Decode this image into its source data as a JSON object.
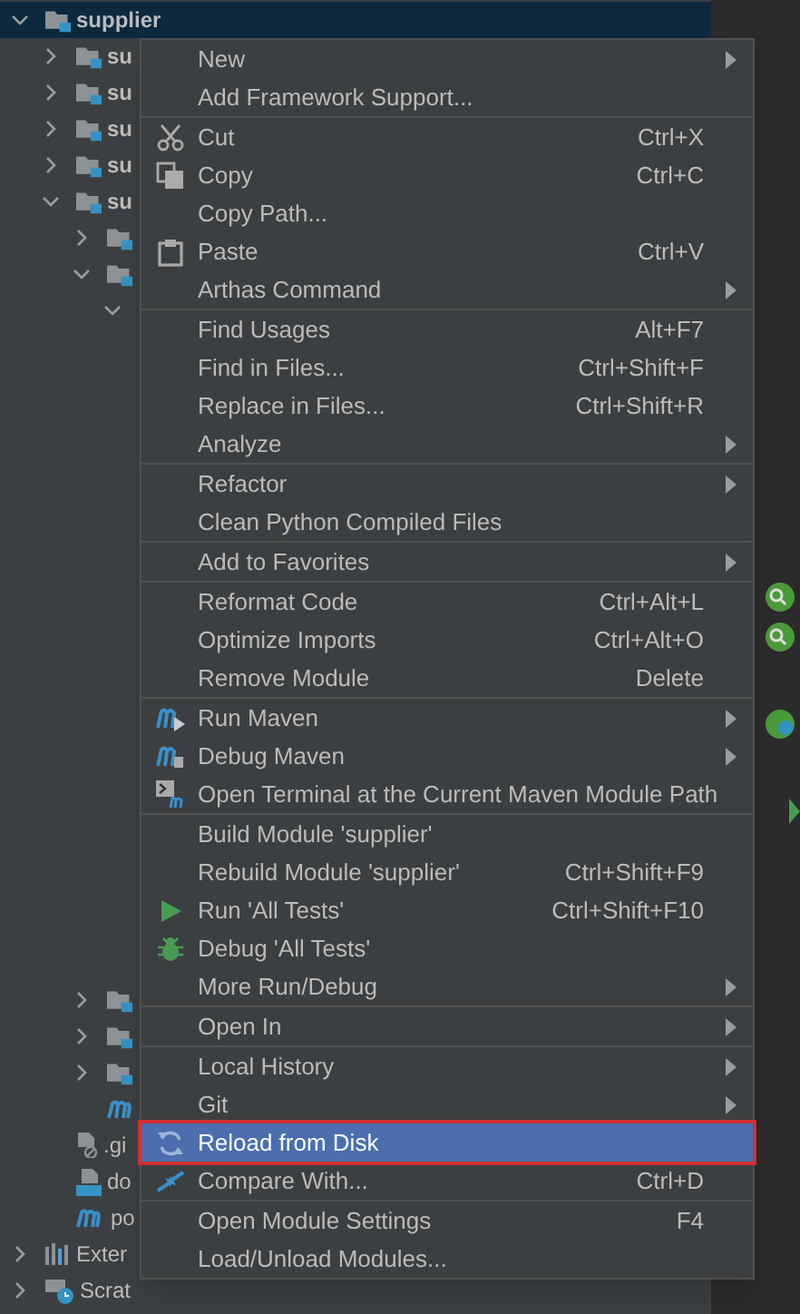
{
  "project_tree": {
    "items": [
      {
        "label": "supplier",
        "kind": "module",
        "expanded": true,
        "selected": true,
        "children": [
          {
            "label": "su",
            "kind": "module",
            "expanded": false,
            "selected": false
          },
          {
            "label": "su",
            "kind": "module",
            "expanded": false,
            "selected": false
          },
          {
            "label": "su",
            "kind": "module",
            "expanded": false,
            "selected": false
          },
          {
            "label": "su",
            "kind": "module",
            "expanded": false,
            "selected": false
          },
          {
            "label": "su",
            "kind": "module",
            "expanded": true,
            "selected": false,
            "children": [
              {
                "kind": "folder",
                "expanded": false,
                "selected": false
              },
              {
                "kind": "folder",
                "expanded": true,
                "selected": false,
                "children": [
                  {
                    "kind": "hidden",
                    "expanded": true
                  }
                ]
              },
              {
                "kind": "folder",
                "expanded": false,
                "selected": false
              },
              {
                "kind": "folder",
                "expanded": false,
                "selected": false
              },
              {
                "kind": "folder",
                "expanded": false,
                "selected": false
              },
              {
                "kind": "maven",
                "selected": false
              }
            ]
          },
          {
            "label": ".gi",
            "kind": "ignore",
            "selected": false
          },
          {
            "label": "do",
            "kind": "docker",
            "selected": false
          },
          {
            "label": "po",
            "kind": "maven",
            "selected": false
          }
        ]
      },
      {
        "label": "Exter",
        "kind": "library",
        "expanded": false,
        "selected": false
      },
      {
        "label": "Scrat",
        "kind": "scratch",
        "expanded": false,
        "selected": false
      }
    ]
  },
  "context_menu": {
    "sections": [
      {
        "items": [
          {
            "label": "New",
            "submenu": true,
            "selected": false
          },
          {
            "label": "Add Framework Support...",
            "submenu": false,
            "selected": false
          }
        ]
      },
      {
        "items": [
          {
            "label": "Cut",
            "shortcut": "Ctrl+X",
            "submenu": false,
            "selected": false
          },
          {
            "label": "Copy",
            "shortcut": "Ctrl+C",
            "submenu": false,
            "selected": false
          },
          {
            "label": "Copy Path...",
            "submenu": false,
            "selected": false
          },
          {
            "label": "Paste",
            "shortcut": "Ctrl+V",
            "submenu": false,
            "selected": false
          },
          {
            "label": "Arthas Command",
            "submenu": true,
            "selected": false
          }
        ]
      },
      {
        "items": [
          {
            "label": "Find Usages",
            "shortcut": "Alt+F7",
            "submenu": false,
            "selected": false
          },
          {
            "label": "Find in Files...",
            "shortcut": "Ctrl+Shift+F",
            "submenu": false,
            "selected": false
          },
          {
            "label": "Replace in Files...",
            "shortcut": "Ctrl+Shift+R",
            "submenu": false,
            "selected": false
          },
          {
            "label": "Analyze",
            "submenu": true,
            "selected": false
          }
        ]
      },
      {
        "items": [
          {
            "label": "Refactor",
            "submenu": true,
            "selected": false
          },
          {
            "label": "Clean Python Compiled Files",
            "submenu": false,
            "selected": false
          }
        ]
      },
      {
        "items": [
          {
            "label": "Add to Favorites",
            "submenu": true,
            "selected": false
          }
        ]
      },
      {
        "items": [
          {
            "label": "Reformat Code",
            "shortcut": "Ctrl+Alt+L",
            "submenu": false,
            "selected": false
          },
          {
            "label": "Optimize Imports",
            "shortcut": "Ctrl+Alt+O",
            "submenu": false,
            "selected": false
          },
          {
            "label": "Remove Module",
            "shortcut": "Delete",
            "submenu": false,
            "selected": false
          }
        ]
      },
      {
        "items": [
          {
            "label": "Run Maven",
            "submenu": true,
            "selected": false
          },
          {
            "label": "Debug Maven",
            "submenu": true,
            "selected": false
          },
          {
            "label": "Open Terminal at the Current Maven Module Path",
            "submenu": false,
            "selected": false
          }
        ]
      },
      {
        "items": [
          {
            "label": "Build Module 'supplier'",
            "submenu": false,
            "selected": false
          },
          {
            "label": "Rebuild Module 'supplier'",
            "shortcut": "Ctrl+Shift+F9",
            "submenu": false,
            "selected": false
          },
          {
            "label": "Run 'All Tests'",
            "shortcut": "Ctrl+Shift+F10",
            "submenu": false,
            "selected": false
          },
          {
            "label": "Debug 'All Tests'",
            "submenu": false,
            "selected": false
          },
          {
            "label": "More Run/Debug",
            "submenu": true,
            "selected": false
          }
        ]
      },
      {
        "items": [
          {
            "label": "Open In",
            "submenu": true,
            "selected": false
          }
        ]
      },
      {
        "items": [
          {
            "label": "Local History",
            "submenu": true,
            "selected": false
          },
          {
            "label": "Git",
            "submenu": true,
            "selected": false
          },
          {
            "label": "Reload from Disk",
            "submenu": false,
            "selected": true
          },
          {
            "label": "Compare With...",
            "shortcut": "Ctrl+D",
            "submenu": false,
            "selected": false
          }
        ]
      },
      {
        "items": [
          {
            "label": "Open Module Settings",
            "shortcut": "F4",
            "submenu": false,
            "selected": false
          },
          {
            "label": "Load/Unload Modules...",
            "submenu": false,
            "selected": false
          }
        ]
      }
    ]
  }
}
